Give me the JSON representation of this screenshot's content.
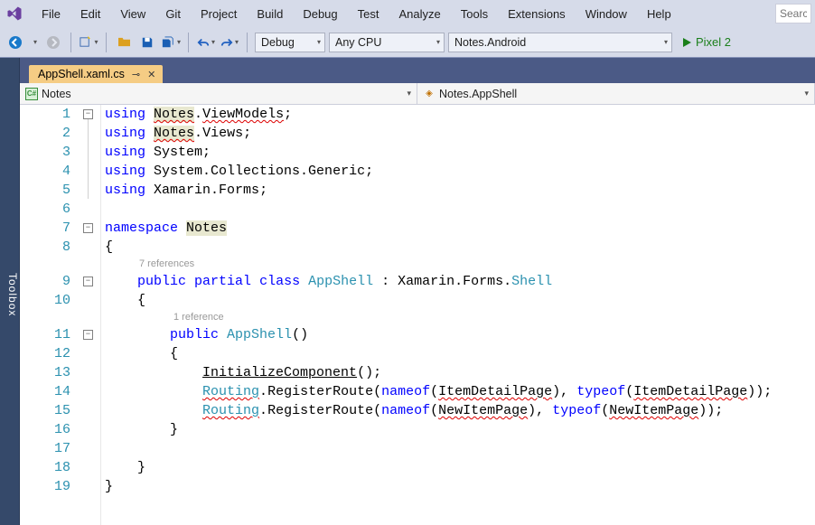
{
  "menu": {
    "items": [
      "File",
      "Edit",
      "View",
      "Git",
      "Project",
      "Build",
      "Debug",
      "Test",
      "Analyze",
      "Tools",
      "Extensions",
      "Window",
      "Help"
    ],
    "search_placeholder": "Search"
  },
  "toolbar": {
    "config": "Debug",
    "platform": "Any CPU",
    "startup": "Notes.Android",
    "run_target": "Pixel 2 "
  },
  "sidebar": {
    "toolbox_label": "Toolbox"
  },
  "tabs": {
    "active": {
      "filename": "AppShell.xaml.cs"
    }
  },
  "nav": {
    "left_icon": "C#",
    "left": "Notes",
    "right_icon": "⤴",
    "right": "Notes.AppShell"
  },
  "codelens": {
    "class_refs": "7 references",
    "ctor_refs": "1 reference"
  },
  "code": {
    "line_numbers": [
      "1",
      "2",
      "3",
      "4",
      "5",
      "6",
      "7",
      "8",
      "9",
      "10",
      "11",
      "12",
      "13",
      "14",
      "15",
      "16",
      "17",
      "18",
      "19"
    ],
    "l1": {
      "kw": "using",
      "a": "Notes",
      "b": "ViewModels"
    },
    "l2": {
      "kw": "using",
      "a": "Notes",
      "b": "Views"
    },
    "l3": {
      "kw": "using",
      "a": "System"
    },
    "l4": {
      "kw": "using",
      "a": "System.Collections.Generic"
    },
    "l5": {
      "kw": "using",
      "a": "Xamarin.Forms"
    },
    "l7": {
      "kw": "namespace",
      "a": "Notes"
    },
    "l9": {
      "kw1": "public",
      "kw2": "partial",
      "kw3": "class",
      "name": "AppShell",
      "base": "Xamarin.Forms.",
      "basecls": "Shell"
    },
    "l11": {
      "kw": "public",
      "name": "AppShell"
    },
    "l13": {
      "call": "InitializeComponent"
    },
    "l14": {
      "r": "Routing",
      "m": "RegisterRoute",
      "no": "nameof",
      "p": "ItemDetailPage",
      "to": "typeof",
      "p2": "ItemDetailPage"
    },
    "l15": {
      "r": "Routing",
      "m": "RegisterRoute",
      "no": "nameof",
      "p": "NewItemPage",
      "to": "typeof",
      "p2": "NewItemPage"
    }
  }
}
